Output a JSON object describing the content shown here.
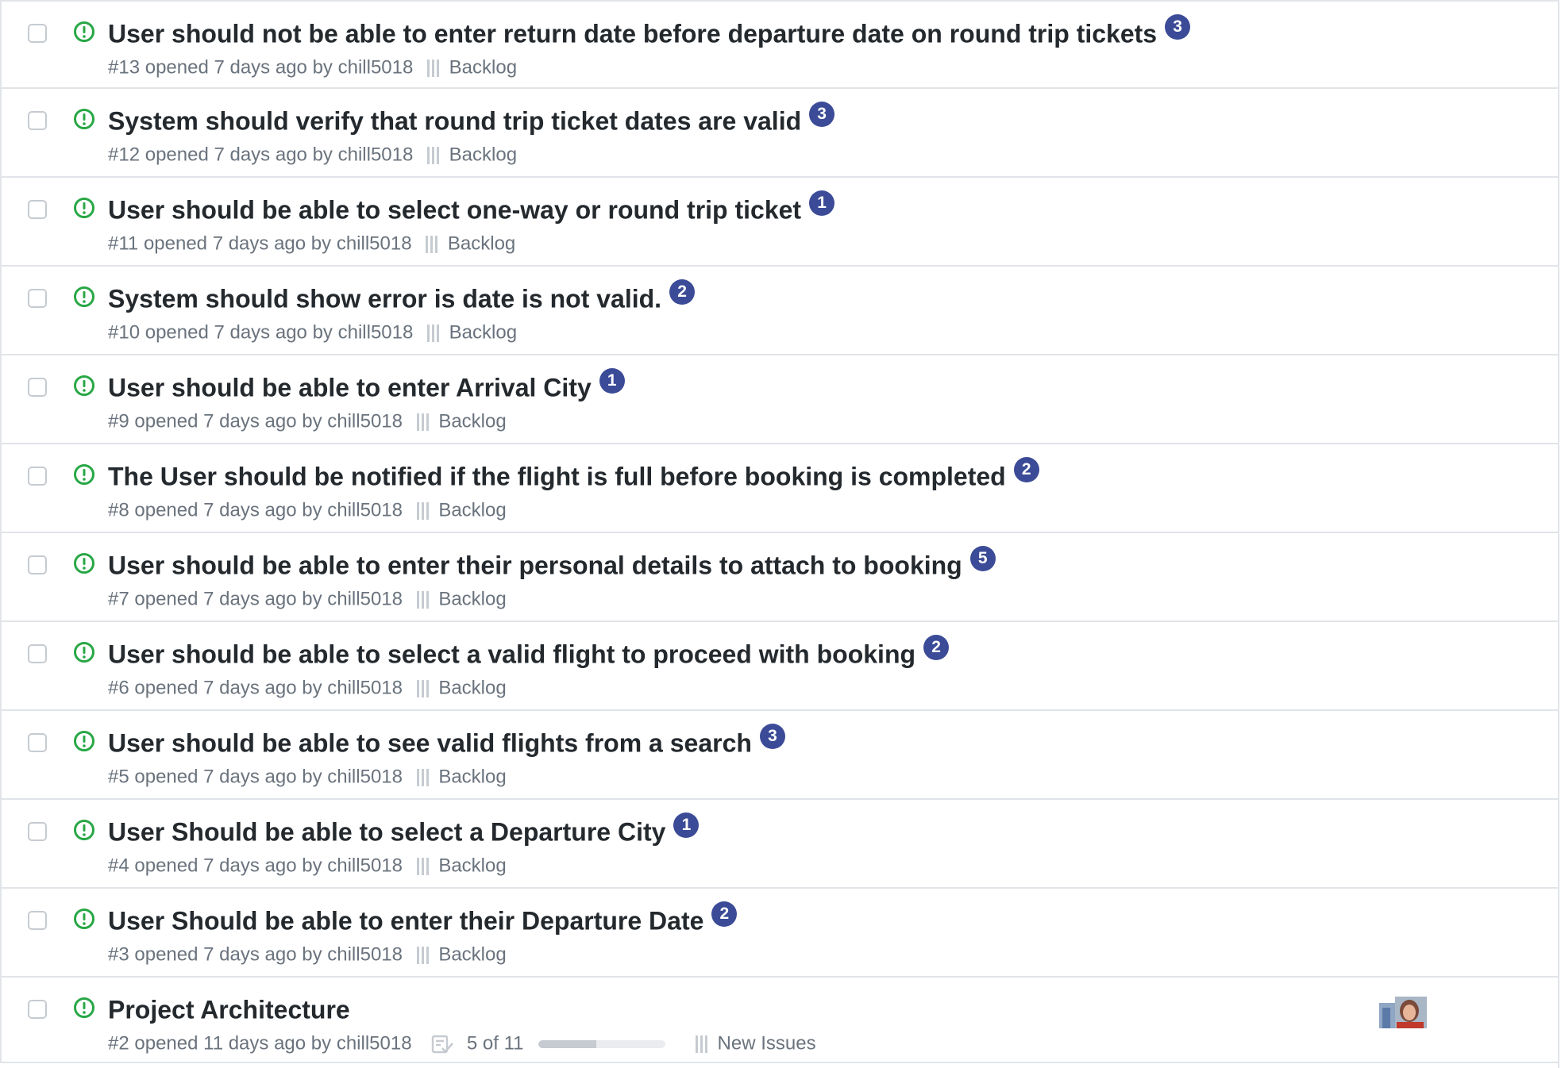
{
  "issues": [
    {
      "title": "User should not be able to enter return date before departure date on round trip tickets",
      "badge": "3",
      "number": "#13",
      "opened": "opened 7 days ago by",
      "author": "chill5018",
      "column": "Backlog"
    },
    {
      "title": "System should verify that round trip ticket dates are valid",
      "badge": "3",
      "number": "#12",
      "opened": "opened 7 days ago by",
      "author": "chill5018",
      "column": "Backlog"
    },
    {
      "title": "User should be able to select one-way or round trip ticket",
      "badge": "1",
      "number": "#11",
      "opened": "opened 7 days ago by",
      "author": "chill5018",
      "column": "Backlog"
    },
    {
      "title": "System should show error is date is not valid.",
      "badge": "2",
      "number": "#10",
      "opened": "opened 7 days ago by",
      "author": "chill5018",
      "column": "Backlog"
    },
    {
      "title": "User should be able to enter Arrival City",
      "badge": "1",
      "number": "#9",
      "opened": "opened 7 days ago by",
      "author": "chill5018",
      "column": "Backlog"
    },
    {
      "title": "The User should be notified if the flight is full before booking is completed",
      "badge": "2",
      "number": "#8",
      "opened": "opened 7 days ago by",
      "author": "chill5018",
      "column": "Backlog"
    },
    {
      "title": "User should be able to enter their personal details to attach to booking",
      "badge": "5",
      "number": "#7",
      "opened": "opened 7 days ago by",
      "author": "chill5018",
      "column": "Backlog"
    },
    {
      "title": "User should be able to select a valid flight to proceed with booking",
      "badge": "2",
      "number": "#6",
      "opened": "opened 7 days ago by",
      "author": "chill5018",
      "column": "Backlog"
    },
    {
      "title": "User should be able to see valid flights from a search",
      "badge": "3",
      "number": "#5",
      "opened": "opened 7 days ago by",
      "author": "chill5018",
      "column": "Backlog"
    },
    {
      "title": "User Should be able to select a Departure City",
      "badge": "1",
      "number": "#4",
      "opened": "opened 7 days ago by",
      "author": "chill5018",
      "column": "Backlog"
    },
    {
      "title": "User Should be able to enter their Departure Date",
      "badge": "2",
      "number": "#3",
      "opened": "opened 7 days ago by",
      "author": "chill5018",
      "column": "Backlog"
    }
  ],
  "last_issue": {
    "title": "Project Architecture",
    "number": "#2",
    "opened": "opened 11 days ago by",
    "author": "chill5018",
    "tasks_label": "5 of 11",
    "tasks_done": 5,
    "tasks_total": 11,
    "column": "New Issues",
    "assignee_avatar": "assignee-avatar"
  },
  "colors": {
    "open_icon": "#28a745",
    "badge_bg": "#3b4b97",
    "meta_text": "#6a737d",
    "border": "#e1e4e8"
  },
  "icons": {
    "status": "issue-opened-icon",
    "column": "project-column-icon",
    "tasklist": "tasklist-icon"
  }
}
